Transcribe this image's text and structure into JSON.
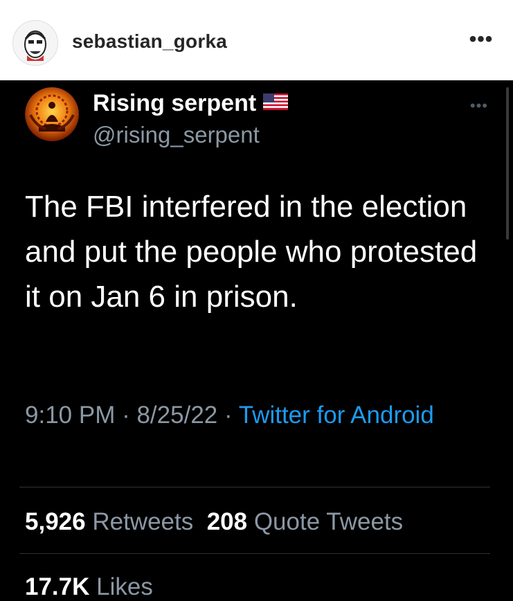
{
  "instagram": {
    "username": "sebastian_gorka",
    "more_icon": "more-horizontal-icon"
  },
  "tweet": {
    "display_name": "Rising serpent",
    "flag_icon": "us-flag-icon",
    "handle": "@rising_serpent",
    "text": "The FBI interfered in the election and put the people who protested it on Jan 6 in prison.",
    "time": "9:10 PM",
    "date": "8/25/22",
    "separator": " · ",
    "source": "Twitter for Android",
    "retweets_count": "5,926",
    "retweets_label": "Retweets",
    "quote_count": "208",
    "quote_label": "Quote Tweets",
    "likes_count": "17.7K",
    "likes_label": "Likes",
    "accent_color": "#1d9bf0"
  }
}
